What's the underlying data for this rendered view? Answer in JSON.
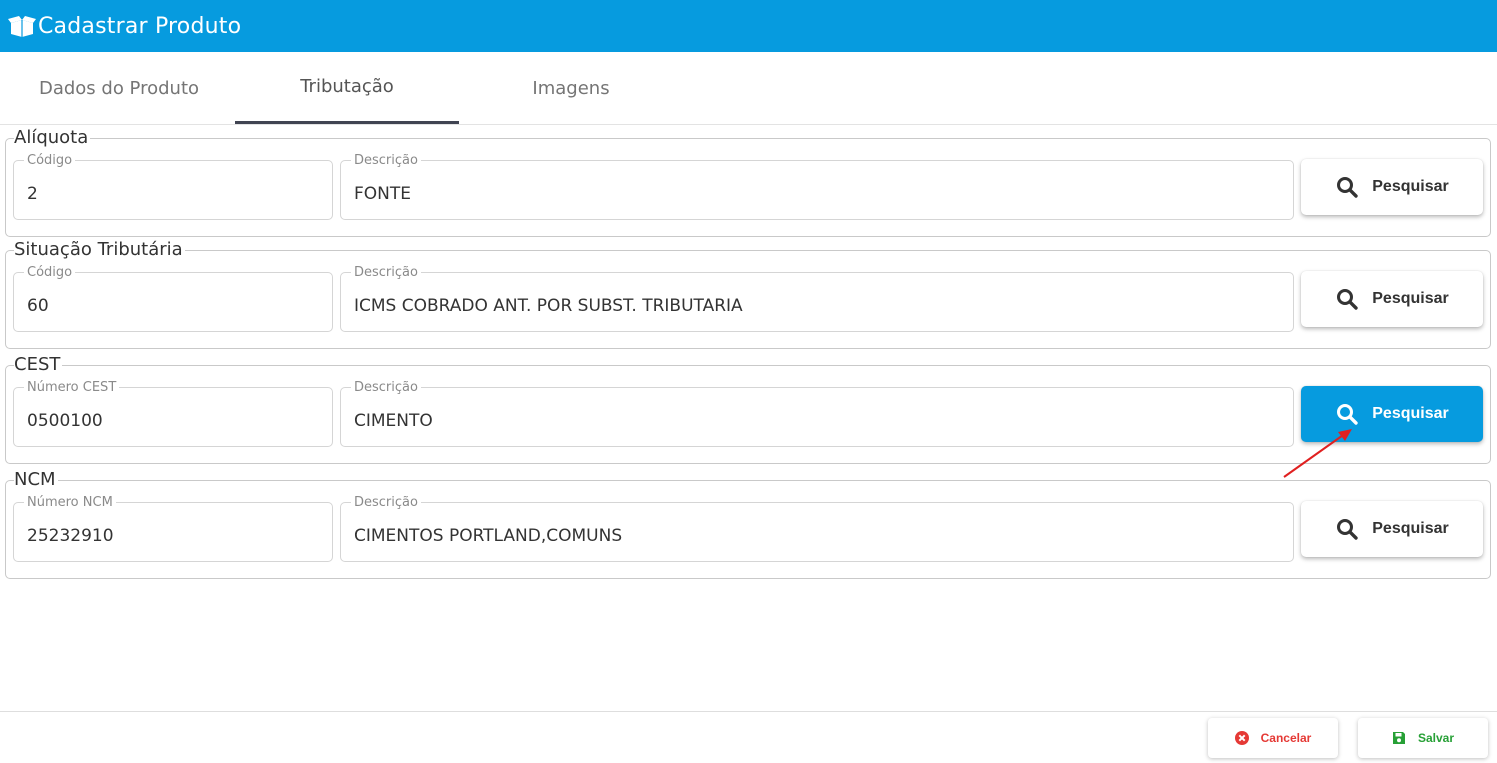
{
  "header": {
    "title": "Cadastrar Produto",
    "icon": "box-open-icon",
    "color": "#069bdf"
  },
  "tabs": [
    {
      "label": "Dados do Produto",
      "active": false
    },
    {
      "label": "Tributação",
      "active": true
    },
    {
      "label": "Imagens",
      "active": false
    }
  ],
  "sections": {
    "aliquota": {
      "title": "Alíquota",
      "code_label": "Código",
      "code_value": "2",
      "desc_label": "Descrição",
      "desc_value": "FONTE",
      "button_label": "Pesquisar"
    },
    "situacao": {
      "title": "Situação Tributária",
      "code_label": "Código",
      "code_value": "60",
      "desc_label": "Descrição",
      "desc_value": "ICMS COBRADO ANT. POR SUBST. TRIBUTARIA",
      "button_label": "Pesquisar"
    },
    "cest": {
      "title": "CEST",
      "code_label": "Número CEST",
      "code_value": "0500100",
      "desc_label": "Descrição",
      "desc_value": "CIMENTO",
      "button_label": "Pesquisar"
    },
    "ncm": {
      "title": "NCM",
      "code_label": "Número NCM",
      "code_value": "25232910",
      "desc_label": "Descrição",
      "desc_value": "CIMENTOS PORTLAND,COMUNS",
      "button_label": "Pesquisar"
    }
  },
  "footer": {
    "cancel_label": "Cancelar",
    "save_label": "Salvar",
    "cancel_color": "#e53935",
    "save_color": "#27a036"
  }
}
